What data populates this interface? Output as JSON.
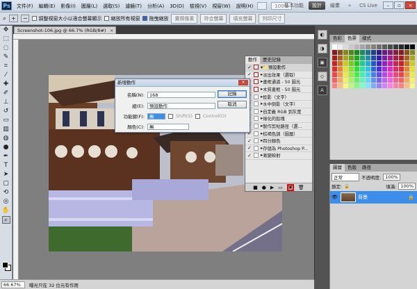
{
  "menubar": {
    "logo": "Ps",
    "items": [
      "文件(F)",
      "編輯(E)",
      "影像(I)",
      "圖層(L)",
      "選取(S)",
      "濾鏡(T)",
      "分析(A)",
      "3D(D)",
      "檢視(V)",
      "視窗(W)",
      "說明(H)"
    ],
    "zoom": "100%",
    "workspaces": [
      "基本功能",
      "設計",
      "繪畫"
    ],
    "active_workspace": "設計",
    "overflow": "»",
    "cs_live": "CS Live"
  },
  "options": {
    "chk1": "調整視窗大小以適合螢幕顯示",
    "chk2": "縮放所有視窗",
    "chk3": "拖曳縮放",
    "btn1": "實際像素",
    "btn2": "符合螢幕",
    "btn3": "填充螢幕",
    "btn4": "列印尺寸"
  },
  "document": {
    "tab_label": "Screenshot-106.jpg @ 66.7% (RGB/8#)",
    "tab_close": "×"
  },
  "status": {
    "zoom": "66.67%",
    "text": "曝光只在 32 位元有作用"
  },
  "actions_panel": {
    "tabs": [
      "動作",
      "歷史記錄"
    ],
    "set_name": "預設動作",
    "items": [
      "淡出效果（選取）",
      "畫框通道 - 50 圖元",
      "木質畫框 - 50 圖元",
      "投影（文字）",
      "水中倒影（文字）",
      "自定義 RGB 到灰度",
      "熔化的鉛塊",
      "製作剪貼路徑（選...",
      "棕褐色調（圖層）",
      "四分顏色",
      "存儲為 Photoshop P...",
      "漸變映射"
    ]
  },
  "swatch_panel": {
    "tabs": [
      "色彩",
      "色票",
      "樣式"
    ]
  },
  "layers_panel": {
    "tabs": [
      "圖層",
      "色版",
      "路徑"
    ],
    "blend_mode": "正常",
    "opacity_label": "不透明度:",
    "opacity": "100%",
    "lock_label": "鎖定:",
    "fill_label": "填滿:",
    "fill": "100%",
    "layer_name": "背景"
  },
  "dialog": {
    "title": "新增動作",
    "close": "×",
    "name_label": "名稱(N):",
    "name_value": "168",
    "set_label": "組(E):",
    "set_value": "預設動作",
    "fkey_label": "功能鍵(F):",
    "fkey_value": "無",
    "shift_label": "Shift(S)",
    "ctrl_label": "Control(O)",
    "color_label": "顏色(C):",
    "color_value": "無",
    "record_btn": "記錄",
    "cancel_btn": "取消"
  }
}
